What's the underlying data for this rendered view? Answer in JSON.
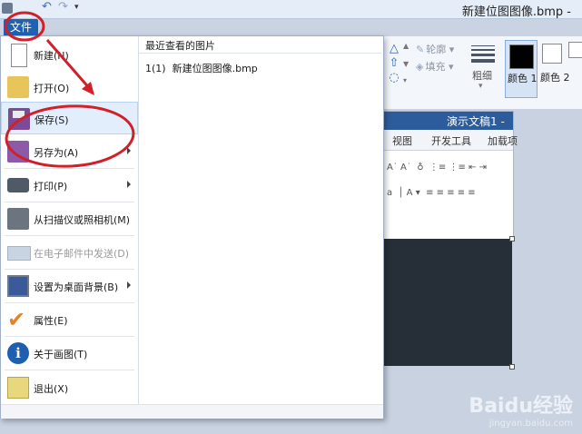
{
  "window": {
    "document_title": "新建位图图像.bmp -"
  },
  "quick_access": {
    "icons": [
      "save-icon",
      "undo-icon",
      "redo-icon",
      "customize-icon"
    ]
  },
  "file_tab": {
    "label": "文件"
  },
  "file_menu": {
    "items": [
      {
        "label": "新建(N)",
        "icon": "new-document-icon"
      },
      {
        "label": "打开(O)",
        "icon": "open-folder-icon"
      },
      {
        "label": "保存(S)",
        "icon": "save-floppy-icon"
      },
      {
        "label": "另存为(A)",
        "icon": "save-as-icon"
      },
      {
        "label": "打印(P)",
        "icon": "printer-icon"
      },
      {
        "label": "从扫描仪或照相机(M)",
        "icon": "scanner-icon"
      },
      {
        "label": "在电子邮件中发送(D)",
        "icon": "email-icon"
      },
      {
        "label": "设置为桌面背景(B)",
        "icon": "desktop-icon"
      },
      {
        "label": "属性(E)",
        "icon": "checkmark-icon"
      },
      {
        "label": "关于画图(T)",
        "icon": "info-icon"
      },
      {
        "label": "退出(X)",
        "icon": "exit-icon"
      }
    ],
    "recent": {
      "title": "最近查看的图片",
      "items": [
        {
          "index": "1(1)",
          "name": "新建位图图像.bmp"
        }
      ]
    }
  },
  "ribbon": {
    "outline_label": "轮廓",
    "fill_label": "填充",
    "size_label": "粗细",
    "color1_label": "颜色 1",
    "color2_label": "颜色 2",
    "color1": "#000000",
    "color2": "#ffffff"
  },
  "inner_screenshot": {
    "title": "演示文稿1 -",
    "tabs": [
      "视图",
      "开发工具",
      "加载项"
    ]
  },
  "watermark": {
    "main": "Baidu经验",
    "sub": "jingyan.baidu.com"
  },
  "annotation_color": "#d0202a"
}
